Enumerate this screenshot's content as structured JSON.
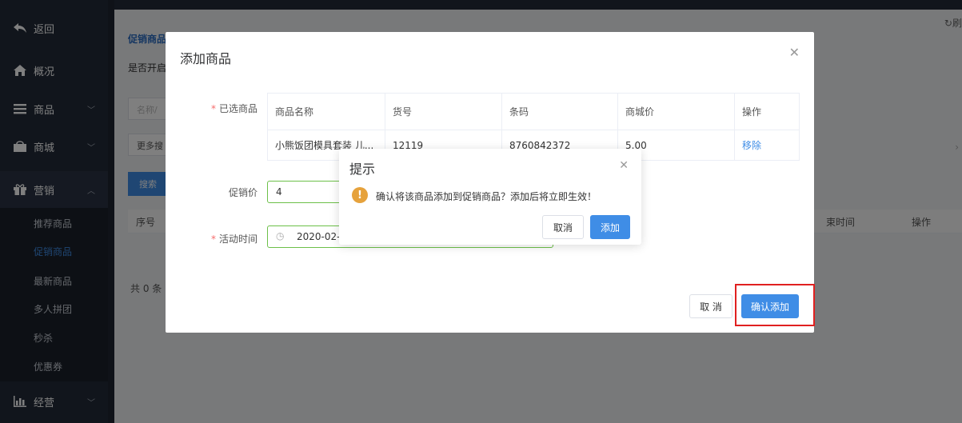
{
  "sidebar": {
    "items": [
      {
        "label": "返回",
        "icon": "back-arrow-icon"
      },
      {
        "label": "概况",
        "icon": "home-icon"
      },
      {
        "label": "商品",
        "icon": "menu-list-icon"
      },
      {
        "label": "商城",
        "icon": "shop-bag-icon"
      },
      {
        "label": "营销",
        "icon": "gift-icon"
      },
      {
        "label": "经营",
        "icon": "bar-chart-icon"
      }
    ],
    "submenu": [
      "推荐商品",
      "促销商品",
      "最新商品",
      "多人拼团",
      "秒杀",
      "优惠券"
    ],
    "active_sub": "促销商品"
  },
  "page": {
    "refresh_label": "刷",
    "title": "促销商品",
    "row1": "是否开启",
    "name_placeholder": "名称/",
    "more_search": "更多搜",
    "search_btn": "搜索",
    "columns": [
      "序号",
      "束时间",
      "操作"
    ],
    "total": "共 0 条"
  },
  "dialog": {
    "title": "添加商品",
    "selected_label": "已选商品",
    "price_label": "促销价",
    "time_label": "活动时间",
    "table": {
      "headers": [
        "商品名称",
        "货号",
        "条码",
        "商城价",
        "操作"
      ],
      "rows": [
        {
          "name": "小熊饭团模具套装 儿...",
          "sku": "12119",
          "barcode": "8760842372",
          "price": "5.00",
          "action": "移除"
        }
      ]
    },
    "price_value": "4",
    "time_value": "2020-02-",
    "cancel_label": "取 消",
    "confirm_label": "确认添加"
  },
  "message_box": {
    "title": "提示",
    "message": "确认将该商品添加到促销商品？添加后将立即生效！",
    "cancel_label": "取消",
    "confirm_label": "添加"
  },
  "colors": {
    "sidebar_bg": "#222a38",
    "primary": "#3f8de6",
    "warning": "#e6a23c",
    "highlight": "#e02020",
    "valid_border": "#6cc048"
  }
}
